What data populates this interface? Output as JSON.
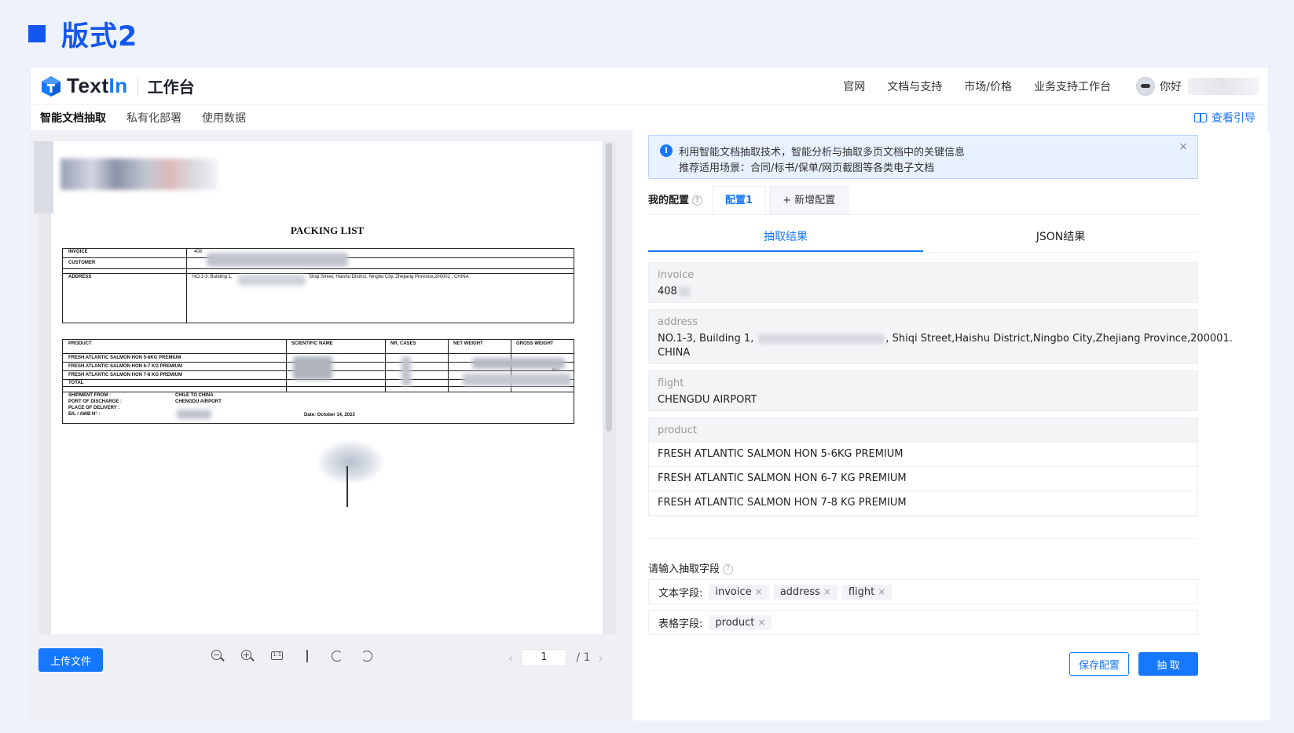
{
  "slide": {
    "title": "版式2"
  },
  "header": {
    "brand_prefix": "Text",
    "brand_suffix": "In",
    "workspace": "工作台",
    "nav": [
      "官网",
      "文档与支持",
      "市场/价格",
      "业务支持工作台"
    ],
    "greeting": "你好"
  },
  "subnav": {
    "items": [
      "智能文档抽取",
      "私有化部署",
      "使用数据"
    ],
    "guide": "查看引导"
  },
  "document": {
    "title": "PACKING LIST",
    "rows": {
      "invoice": "INVOICE",
      "invoice_val": "408",
      "customer": "CUSTOMER",
      "address": "ADDRESS",
      "address_val_a": "NO.1-3, Building 1,",
      "address_val_b": "Shiqi  Street, Haishu District, Ningbo City, Zhejiang Province,200001 ,  CHINA"
    },
    "columns": [
      "PRODUCT",
      "SCIENTIFIC NAME",
      "NR. CASES",
      "NET WEIGHT",
      "GROSS WEIGHT"
    ],
    "products": [
      "FRESH ATLANTIC SALMON HON 5-6KG PREMIUM",
      "FRESH ATLANTIC SALMON HON 6-7 KG PREMIUM",
      "FRESH ATLANTIC SALMON HON 7-8 KG PREMIUM"
    ],
    "gross_unit": "KG",
    "total": "TOTAL",
    "meta_labels": [
      "SHIPMENT FROM :",
      "PORT OF DISCHARGE :",
      "PLACE OF DELIVERY :",
      "B/L / AWB N° :"
    ],
    "meta_values": [
      "CHILE TO CHINA",
      "CHENGDU AIRPORT"
    ],
    "date": "Date: October 14, 2023"
  },
  "toolbar": {
    "upload": "上传文件",
    "page_value": "1",
    "page_total": "/ 1",
    "prev": "‹",
    "next": "›"
  },
  "alert": {
    "line1": "利用智能文档抽取技术，智能分析与抽取多页文档中的关键信息",
    "line2": "推荐适用场景：合同/标书/保单/网页截图等各类电子文档",
    "close": "×"
  },
  "config": {
    "label": "我的配置",
    "tab1": "配置1",
    "add": "+ 新增配置"
  },
  "result_tabs": [
    "抽取结果",
    "JSON结果"
  ],
  "results": {
    "invoice": {
      "label": "invoice",
      "value": "408"
    },
    "address": {
      "label": "address",
      "value_a": "NO.1-3, Building 1,",
      "value_b": ", Shiqi Street,Haishu District,Ningbo City,Zhejiang Province,200001.",
      "value_c": "CHINA"
    },
    "flight": {
      "label": "flight",
      "value": "CHENGDU AIRPORT"
    },
    "product": {
      "label": "product",
      "rows": [
        "FRESH ATLANTIC SALMON HON 5-6KG PREMIUM",
        "FRESH ATLANTIC SALMON HON 6-7 KG PREMIUM",
        "FRESH ATLANTIC SALMON HON 7-8 KG PREMIUM"
      ]
    }
  },
  "fields": {
    "prompt": "请输入抽取字段",
    "text_label": "文本字段:",
    "text_tags": [
      "invoice",
      "address",
      "flight"
    ],
    "table_label": "表格字段:",
    "table_tags": [
      "product"
    ],
    "tag_close": "×"
  },
  "actions": {
    "save": "保存配置",
    "extract": "抽 取"
  },
  "colors": {
    "primary": "#1677ff",
    "slide_title": "#1456f0",
    "background": "#eef3fb"
  }
}
